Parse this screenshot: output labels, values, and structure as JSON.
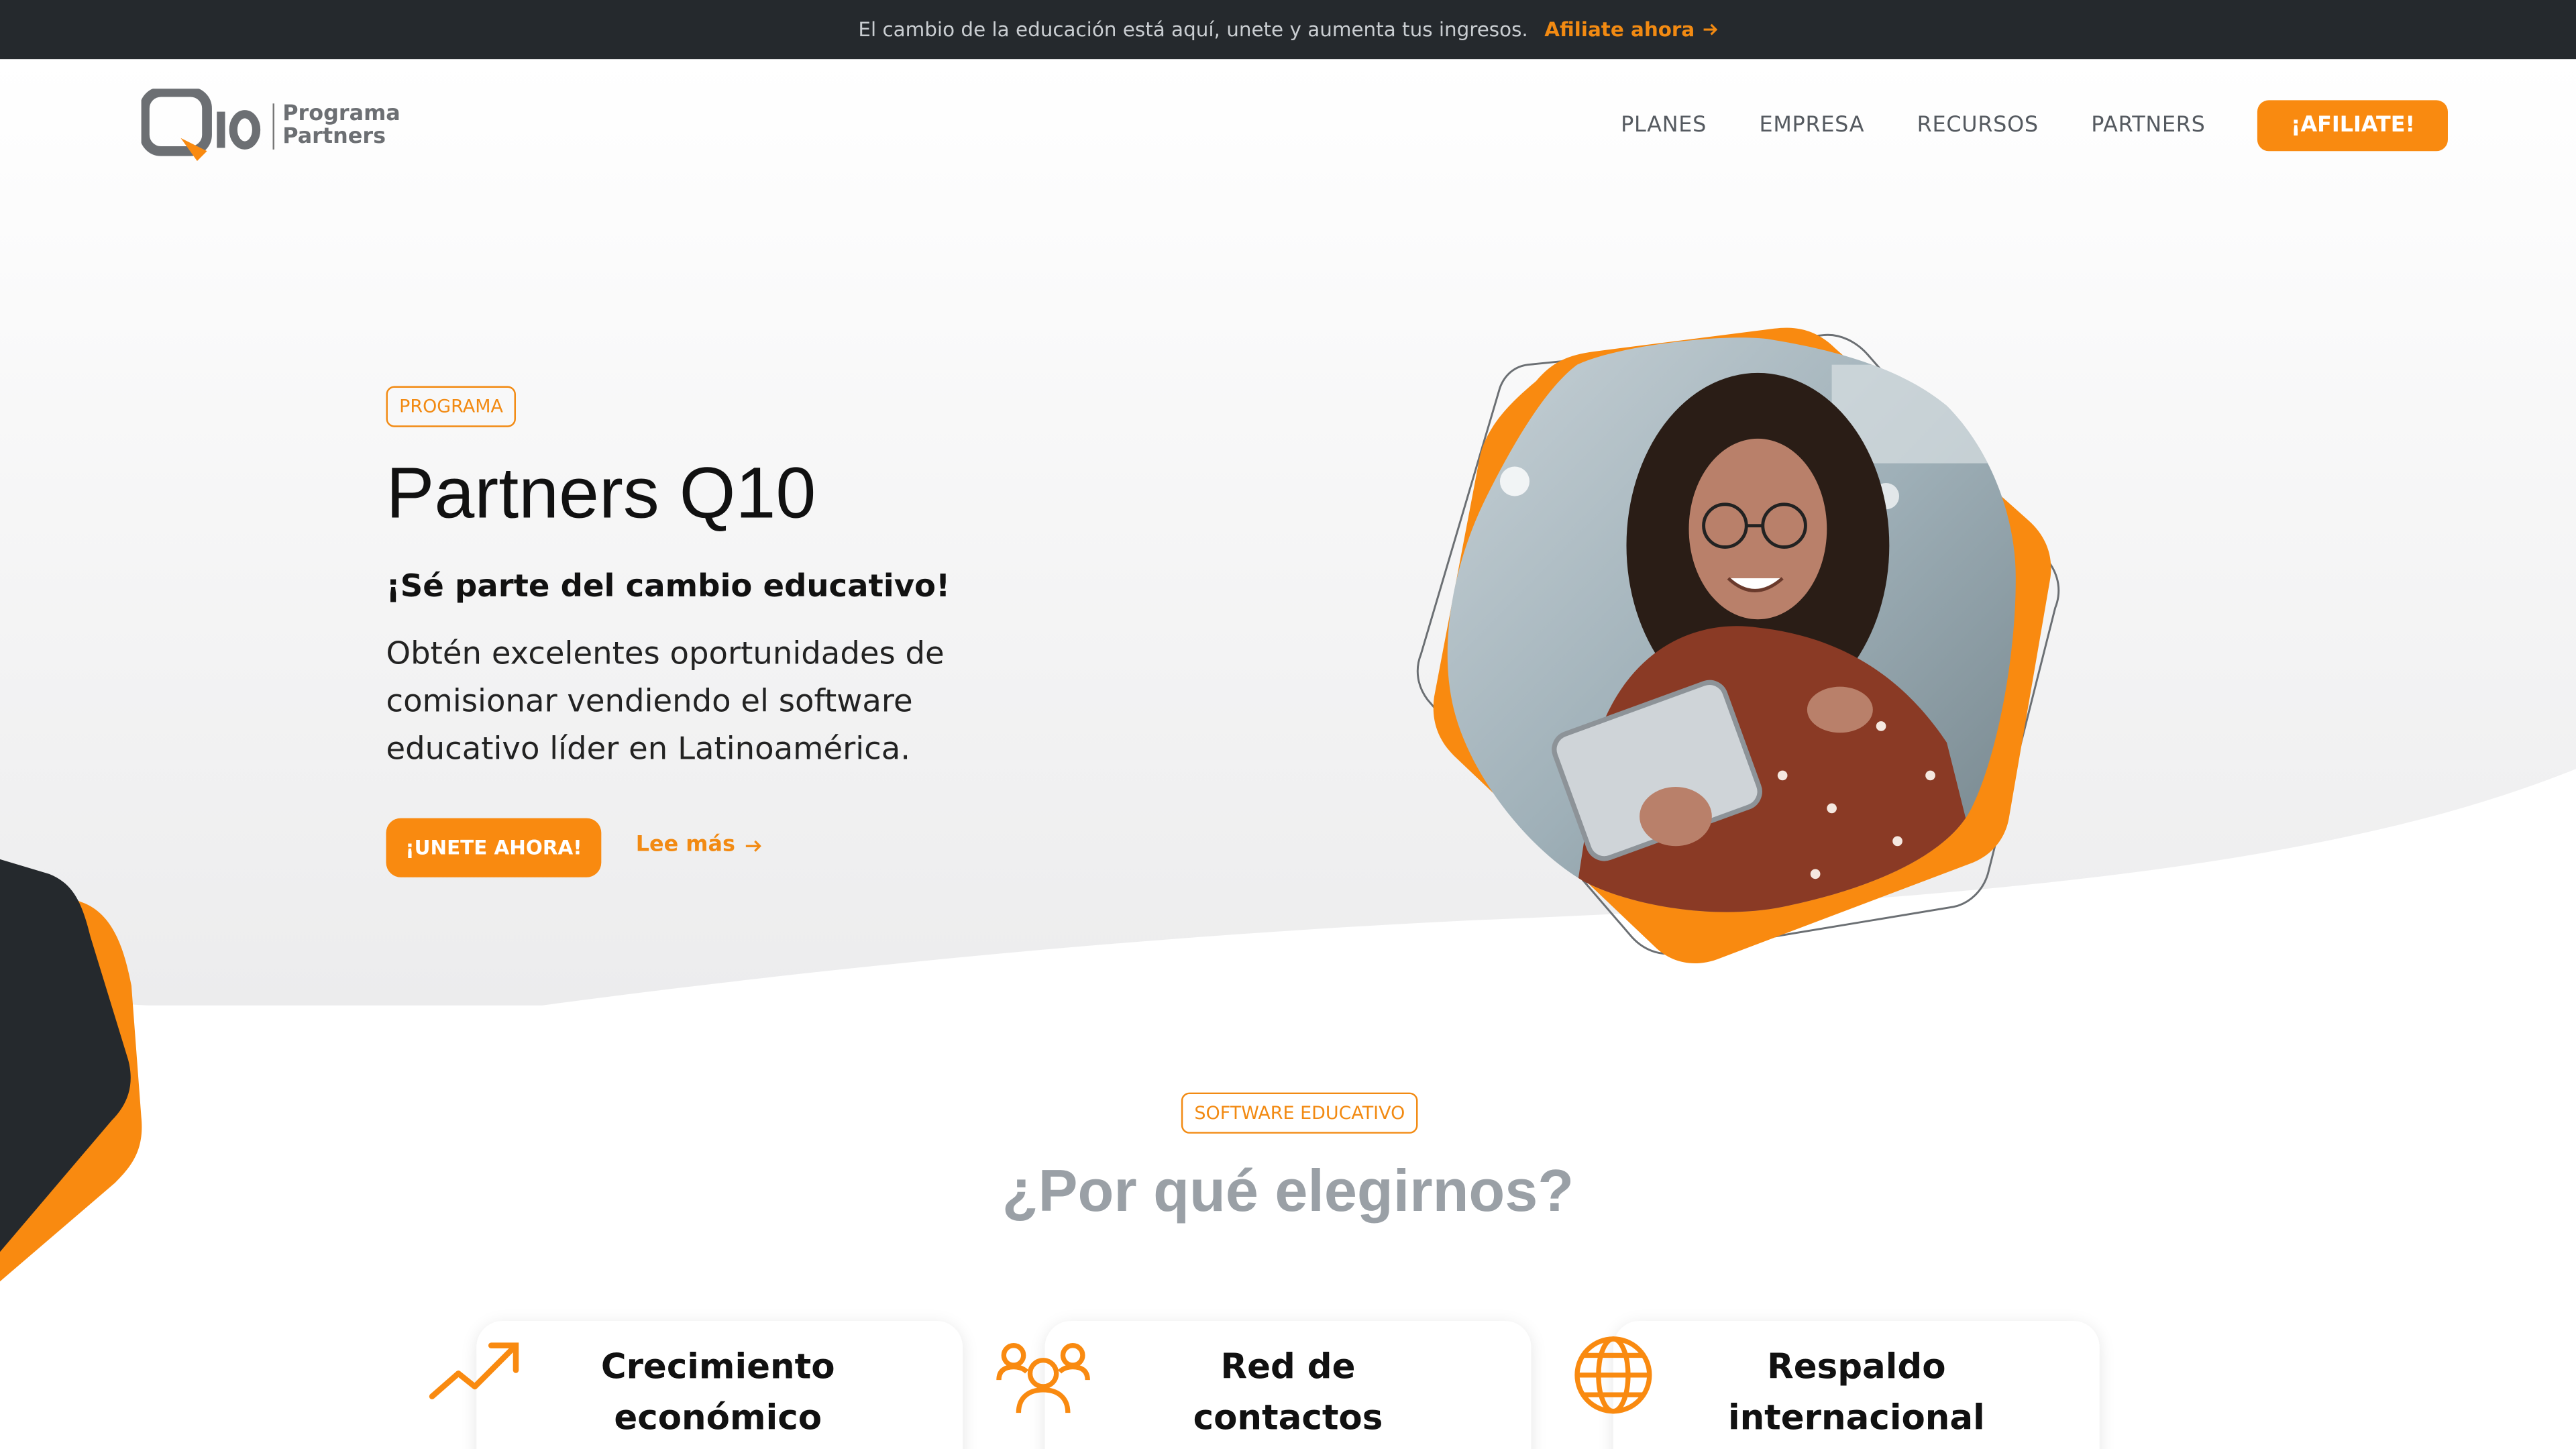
{
  "announcement": {
    "text": "El cambio de la educación está aquí, unete y aumenta tus ingresos.",
    "link": "Afiliate ahora"
  },
  "logo": {
    "mark": "Q10",
    "line1": "Programa",
    "line2": "Partners"
  },
  "nav": {
    "items": [
      "PLANES",
      "EMPRESA",
      "RECURSOS",
      "PARTNERS"
    ],
    "cta": "¡AFILIATE!"
  },
  "hero": {
    "tag": "PROGRAMA",
    "title": "Partners Q10",
    "subtitle": "¡Sé parte del cambio educativo!",
    "description": "Obtén excelentes oportunidades de comisionar vendiendo el software educativo líder en Latinoamérica.",
    "primary_button": "¡UNETE AHORA!",
    "secondary_link": "Lee más"
  },
  "why": {
    "tag": "SOFTWARE EDUCATIVO",
    "title": "¿Por qué elegirnos?",
    "cards": [
      {
        "title": "Crecimiento económico",
        "icon": "trend-up-icon"
      },
      {
        "title": "Red de contactos",
        "icon": "users-icon"
      },
      {
        "title": "Respaldo internacional",
        "icon": "globe-icon"
      }
    ]
  },
  "colors": {
    "accent": "#f98a10",
    "dark": "#25292d",
    "muted_title": "#9aa0a6"
  }
}
